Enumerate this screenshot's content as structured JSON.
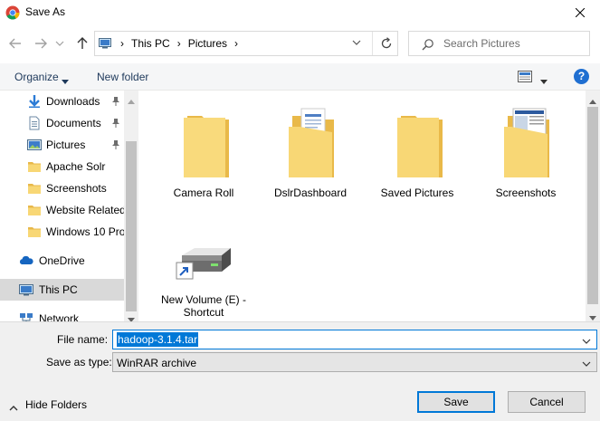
{
  "window": {
    "title": "Save As"
  },
  "address": {
    "crumbs": [
      "This PC",
      "Pictures"
    ]
  },
  "search": {
    "placeholder": "Search Pictures"
  },
  "toolbar": {
    "organize": "Organize",
    "new_folder": "New folder"
  },
  "sidebar": {
    "items": [
      {
        "label": "Downloads",
        "icon": "download-arrow-icon",
        "pinned": true
      },
      {
        "label": "Documents",
        "icon": "documents-icon",
        "pinned": true
      },
      {
        "label": "Pictures",
        "icon": "pictures-icon",
        "pinned": true
      },
      {
        "label": "Apache Solr",
        "icon": "folder-icon"
      },
      {
        "label": "Screenshots",
        "icon": "folder-icon"
      },
      {
        "label": "Website Related",
        "icon": "folder-icon"
      },
      {
        "label": "Windows 10 Pro",
        "icon": "folder-icon"
      },
      {
        "label": "OneDrive",
        "icon": "cloud-icon"
      },
      {
        "label": "This PC",
        "icon": "computer-icon",
        "selected": true
      },
      {
        "label": "Network",
        "icon": "network-icon"
      }
    ]
  },
  "content": {
    "items": [
      {
        "name": "Camera Roll",
        "type": "folder"
      },
      {
        "name": "DslrDashboard",
        "type": "folder-with-docs"
      },
      {
        "name": "Saved Pictures",
        "type": "folder"
      },
      {
        "name": "Screenshots",
        "type": "folder-with-screens"
      },
      {
        "name": "New Volume (E) - Shortcut",
        "type": "drive-shortcut"
      }
    ]
  },
  "form": {
    "file_name_label": "File name:",
    "file_name_value": "hadoop-3.1.4.tar",
    "save_type_label": "Save as type:",
    "save_type_value": "WinRAR archive",
    "hide_folders": "Hide Folders",
    "save": "Save",
    "cancel": "Cancel"
  },
  "colors": {
    "accent": "#0078d7",
    "folder": "#f8d775",
    "selection": "#cce8ff"
  }
}
